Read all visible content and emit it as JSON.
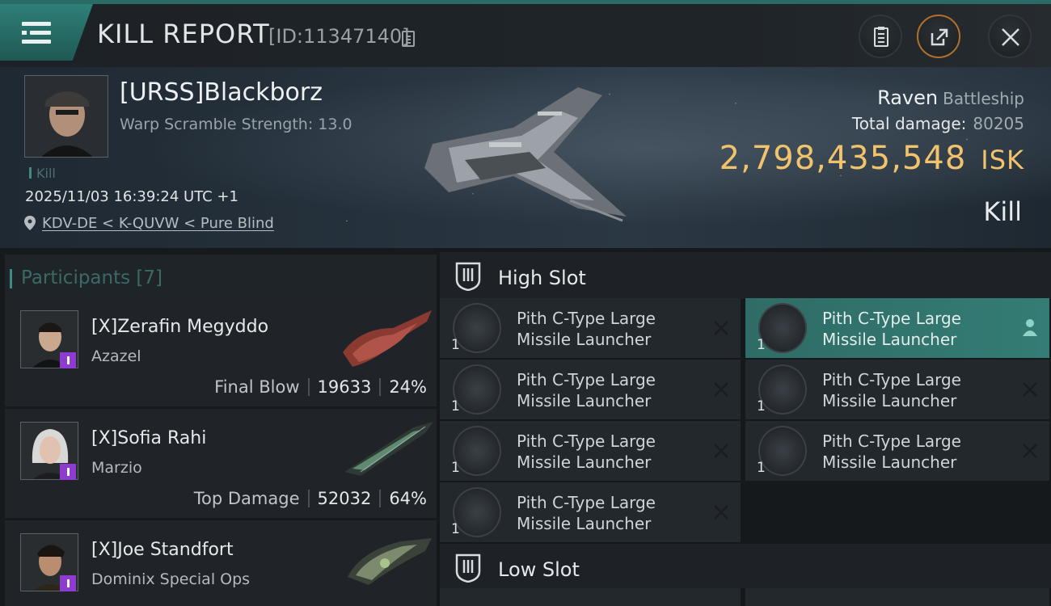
{
  "header": {
    "title": "KILL REPORT",
    "report_id": "[ID:11347140]",
    "icons": [
      "menu-icon",
      "copy-icon",
      "clipboard-icon",
      "share-icon",
      "close-icon"
    ]
  },
  "victim": {
    "name": "[URSS]Blackborz",
    "warp_scramble": "Warp Scramble Strength: 13.0",
    "kill_tag": "Kill",
    "datetime": "2025/11/03 16:39:24 UTC +1",
    "location": "KDV-DE < K-QUVW < Pure Blind",
    "ship": "Raven",
    "ship_class": "Battleship",
    "total_damage_label": "Total damage:",
    "total_damage": "80205",
    "isk_value": "2,798,435,548",
    "isk_unit": "ISK",
    "result": "Kill"
  },
  "participants": {
    "title": "Participants [7]",
    "rows": [
      {
        "name": "[X]Zerafin Megyddo",
        "ship": "Azazel",
        "role": "Final Blow",
        "damage": "19633",
        "percent": "24%"
      },
      {
        "name": "[X]Sofia Rahi",
        "ship": "Marzio",
        "role": "Top Damage",
        "damage": "52032",
        "percent": "64%"
      },
      {
        "name": "[X]Joe Standfort",
        "ship": "Dominix Special Ops",
        "role": "",
        "damage": "",
        "percent": ""
      }
    ]
  },
  "fitting": {
    "high_slot_title": "High Slot",
    "low_slot_title": "Low Slot",
    "modules": [
      {
        "name": "Pith C-Type Large Missile Launcher",
        "qty": "1",
        "state": "destroyed"
      },
      {
        "name": "Pith C-Type Large Missile Launcher",
        "qty": "1",
        "state": "dropped"
      },
      {
        "name": "Pith C-Type Large Missile Launcher",
        "qty": "1",
        "state": "destroyed"
      },
      {
        "name": "Pith C-Type Large Missile Launcher",
        "qty": "1",
        "state": "destroyed"
      },
      {
        "name": "Pith C-Type Large Missile Launcher",
        "qty": "1",
        "state": "destroyed"
      },
      {
        "name": "Pith C-Type Large Missile Launcher",
        "qty": "1",
        "state": "destroyed"
      },
      {
        "name": "Pith C-Type Large Missile Launcher",
        "qty": "1",
        "state": "destroyed"
      }
    ]
  },
  "colors": {
    "accent": "#2e7f78",
    "isk": "#f0c36c",
    "ship_badge": "#8e3bd1"
  }
}
